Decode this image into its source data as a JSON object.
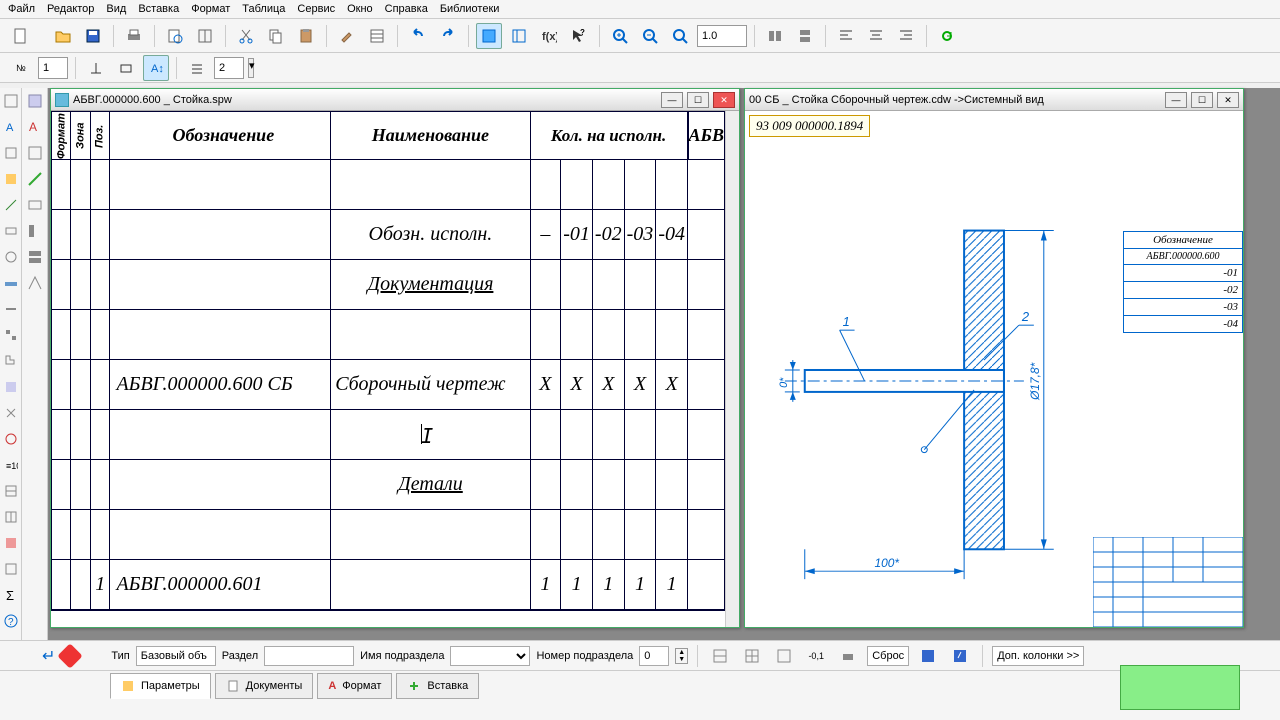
{
  "menu": [
    "Файл",
    "Редактор",
    "Вид",
    "Вставка",
    "Формат",
    "Таблица",
    "Сервис",
    "Окно",
    "Справка",
    "Библиотеки"
  ],
  "toolbar2": {
    "field1": "1",
    "field2": "2"
  },
  "zoom": "1.0",
  "windows": {
    "spec": {
      "title": "АБВГ.000000.600 _ Стойка.spw",
      "headers": {
        "format": "Формат",
        "zone": "Зона",
        "pos": "Поз.",
        "desig": "Обозначение",
        "name": "Наименование",
        "qty_header": "Кол. на исполн.",
        "note": "АБВ"
      },
      "qty_cols": [
        "–",
        "-01",
        "-02",
        "-03",
        "-04"
      ],
      "rows": [
        {
          "name": "Обозн. исполн.",
          "q": [
            "–",
            "-01",
            "-02",
            "-03",
            "-04"
          ]
        },
        {
          "name": "Документация",
          "section": true
        },
        {
          "desig": "АБВГ.000000.600 СБ",
          "name": "Сборочный чертеж",
          "q": [
            "Х",
            "Х",
            "Х",
            "Х",
            "Х"
          ]
        },
        {
          "blank": true
        },
        {
          "name": "Детали",
          "section": true
        },
        {
          "pos": "1",
          "desig": "АБВГ.000000.601",
          "q": [
            "1",
            "1",
            "1",
            "1",
            "1"
          ]
        }
      ]
    },
    "drawing": {
      "title": "00 СБ _ Стойка Сборочный чертеж.cdw ->Системный вид",
      "field_value": "93 009 000000.1894",
      "side_table": {
        "header": "Обозначение",
        "rows": [
          "АБВГ.000000.600",
          "-01",
          "-02",
          "-03",
          "-04"
        ]
      },
      "dims": {
        "width": "100*",
        "height": "Ø17,8*",
        "gap": "0*"
      },
      "callouts": [
        "1",
        "2"
      ]
    }
  },
  "status": {
    "type_label": "Тип",
    "type_value": "Базовый объ",
    "section_label": "Раздел",
    "subsection_name_label": "Имя подраздела",
    "subsection_num_label": "Номер подраздела",
    "subsection_num": "0",
    "reset": "Сброс",
    "extra_cols": "Доп. колонки  >>"
  },
  "tabs": {
    "params": "Параметры",
    "docs": "Документы",
    "format": "Формат",
    "insert": "Вставка"
  }
}
